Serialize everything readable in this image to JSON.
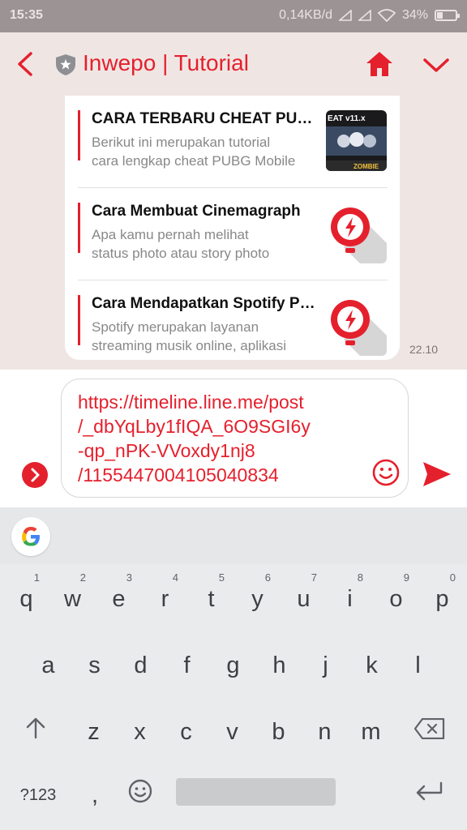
{
  "status": {
    "time": "15:35",
    "speed": "0,14KB/d",
    "battery": "34%"
  },
  "header": {
    "title": "Inwepo | Tutorial"
  },
  "articles": [
    {
      "title": "CARA TERBARU CHEAT PUBG MOBILE",
      "desc1": "Berikut ini merupakan tutorial",
      "desc2": "cara lengkap cheat PUBG Mobile"
    },
    {
      "title": "Cara Membuat Cinemagraph",
      "desc1": "Apa kamu pernah melihat",
      "desc2": "status photo atau story photo"
    },
    {
      "title": "Cara Mendapatkan Spotify Premium",
      "desc1": "Spotify merupakan layanan",
      "desc2": "streaming musik online, aplikasi"
    }
  ],
  "thumb1": {
    "badge": "EAT v11.x",
    "caption": "ZOMBIE"
  },
  "message": {
    "time": "22.10"
  },
  "composer": {
    "line1": "https://timeline.line.me/post",
    "line2": "/_dbYqLby1fIQA_6O9SGI6y",
    "line3": "-qp_nPK-VVoxdy1nj8",
    "line4": "/1155447004105040834"
  },
  "keyboard": {
    "row1": [
      "q",
      "w",
      "e",
      "r",
      "t",
      "y",
      "u",
      "i",
      "o",
      "p"
    ],
    "hints": [
      "1",
      "2",
      "3",
      "4",
      "5",
      "6",
      "7",
      "8",
      "9",
      "0"
    ],
    "row2": [
      "a",
      "s",
      "d",
      "f",
      "g",
      "h",
      "j",
      "k",
      "l"
    ],
    "row3": [
      "z",
      "x",
      "c",
      "v",
      "b",
      "n",
      "m"
    ],
    "sym_label": "?123",
    "comma": ","
  },
  "colors": {
    "accent": "#e5202d",
    "statusbar": "#9c9494",
    "background": "#efe6e4"
  }
}
